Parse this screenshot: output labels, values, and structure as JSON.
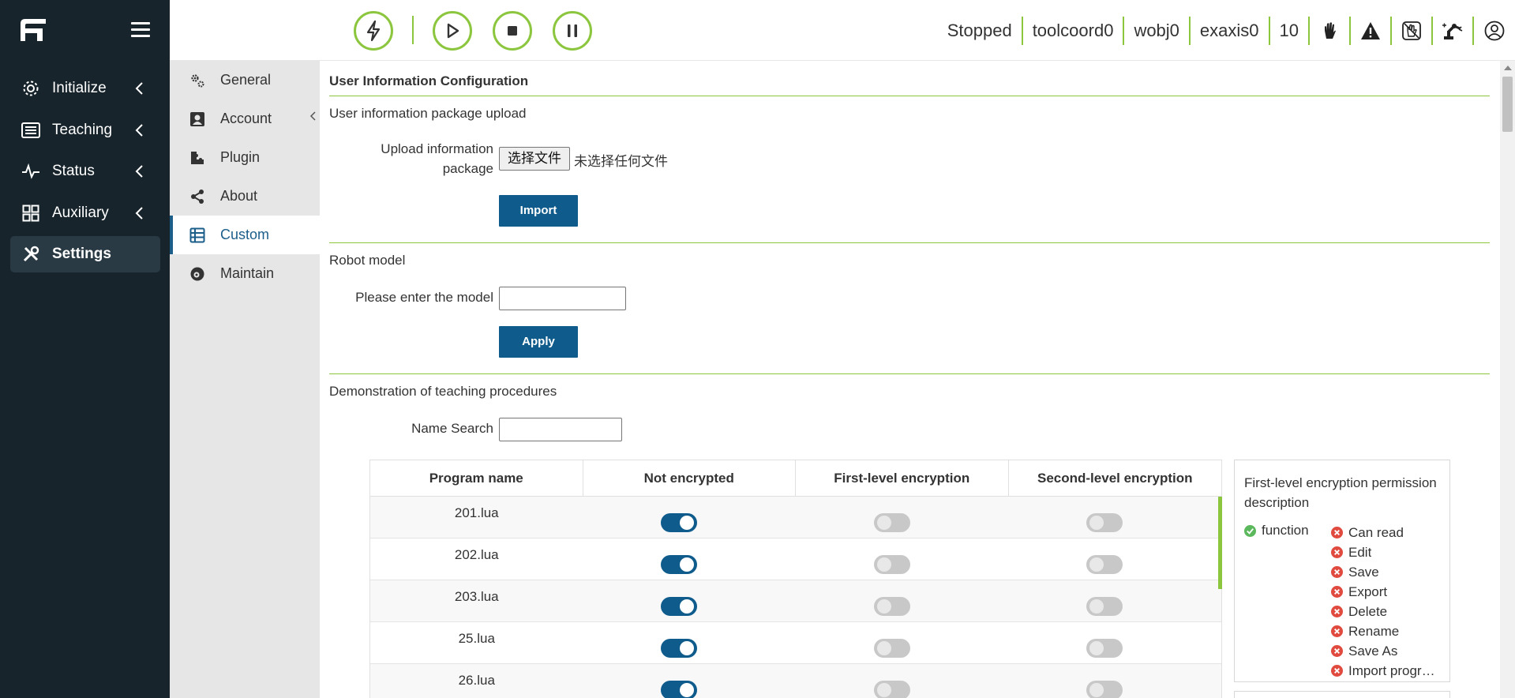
{
  "nav": {
    "items": [
      {
        "label": "Initialize",
        "icon": "gear-icon"
      },
      {
        "label": "Teaching",
        "icon": "list-icon"
      },
      {
        "label": "Status",
        "icon": "pulse-icon"
      },
      {
        "label": "Auxiliary",
        "icon": "grid-icon"
      },
      {
        "label": "Settings",
        "icon": "tools-icon"
      }
    ]
  },
  "submenu": {
    "items": [
      {
        "label": "General",
        "icon": "gears-icon"
      },
      {
        "label": "Account",
        "icon": "account-icon"
      },
      {
        "label": "Plugin",
        "icon": "plugin-icon"
      },
      {
        "label": "About",
        "icon": "share-icon"
      },
      {
        "label": "Custom",
        "icon": "table-icon"
      },
      {
        "label": "Maintain",
        "icon": "maintain-icon"
      }
    ],
    "active": "Custom"
  },
  "topbar": {
    "status": "Stopped",
    "tool": "toolcoord0",
    "wobj": "wobj0",
    "exaxis": "exaxis0",
    "speed": "10"
  },
  "page": {
    "title": "User Information Configuration",
    "upload_section": "User information package upload",
    "upload_label_1": "Upload information",
    "upload_label_2": "package",
    "file_button": "选择文件",
    "file_status": "未选择任何文件",
    "import_button": "Import",
    "robot_section": "Robot model",
    "model_label": "Please enter the model",
    "apply_button": "Apply",
    "demo_section": "Demonstration of teaching procedures",
    "search_label": "Name Search"
  },
  "table": {
    "headers": [
      "Program name",
      "Not encrypted",
      "First-level encryption",
      "Second-level encryption"
    ],
    "rows": [
      {
        "name": "201.lua",
        "level": 0
      },
      {
        "name": "202.lua",
        "level": 0
      },
      {
        "name": "203.lua",
        "level": 0
      },
      {
        "name": "25.lua",
        "level": 0
      },
      {
        "name": "26.lua",
        "level": 0
      }
    ]
  },
  "permission": {
    "title": "First-level encryption permission description",
    "allowed": "function",
    "denied": [
      "Can read",
      "Edit",
      "Save",
      "Export",
      "Delete",
      "Rename",
      "Save As",
      "Import program"
    ]
  },
  "colors": {
    "accent_green": "#8cc63f",
    "primary_blue": "#0f5c8c",
    "nav_bg": "#17242c"
  }
}
